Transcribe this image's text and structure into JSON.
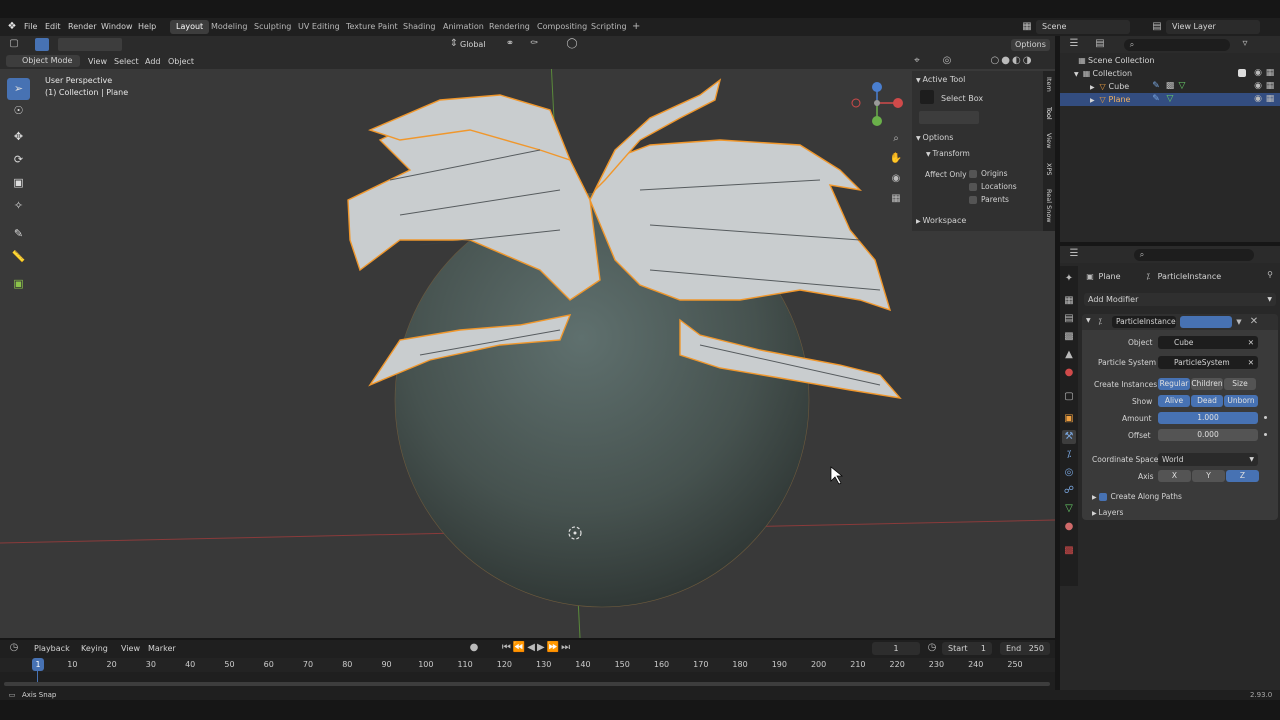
{
  "menubar": {
    "items": [
      "File",
      "Edit",
      "Render",
      "Window",
      "Help"
    ]
  },
  "workspaces": {
    "tabs": [
      "Layout",
      "Modeling",
      "Sculpting",
      "UV Editing",
      "Texture Paint",
      "Shading",
      "Animation",
      "Rendering",
      "Compositing",
      "Scripting"
    ],
    "active": "Layout",
    "add": "+"
  },
  "topright": {
    "scene": "Scene",
    "view_layer": "View Layer"
  },
  "viewport": {
    "mode": "Object Mode",
    "menu": [
      "View",
      "Select",
      "Add",
      "Object"
    ],
    "transform_orientation": "Global",
    "options": "Options",
    "perspective": "User Perspective",
    "collection_info": "(1) Collection | Plane"
  },
  "npanel": {
    "active_tool_header": "Active Tool",
    "tool_name": "Select Box",
    "options_header": "Options",
    "transform_header": "Transform",
    "affect_only_label": "Affect Only",
    "affect_options": [
      "Origins",
      "Locations",
      "Parents"
    ],
    "workspace_header": "Workspace",
    "tabs": [
      "Item",
      "Tool",
      "View",
      "XPS",
      "Real Snow"
    ]
  },
  "outliner": {
    "root": "Scene Collection",
    "collection": "Collection",
    "items": [
      "Cube",
      "Plane"
    ]
  },
  "properties": {
    "object_name": "Plane",
    "modifier_breadcrumb": "ParticleInstance",
    "add_modifier": "Add Modifier",
    "modifier_name": "ParticleInstance",
    "object_label": "Object",
    "object_value": "Cube",
    "particle_system_label": "Particle System",
    "particle_system_value": "ParticleSystem",
    "create_instances_label": "Create Instances",
    "create_instances": [
      "Regular",
      "Children",
      "Size"
    ],
    "show_label": "Show",
    "show": [
      "Alive",
      "Dead",
      "Unborn"
    ],
    "amount_label": "Amount",
    "amount_value": "1.000",
    "offset_label": "Offset",
    "offset_value": "0.000",
    "coord_space_label": "Coordinate Space",
    "coord_space_value": "World",
    "axis_label": "Axis",
    "axis": [
      "X",
      "Y",
      "Z"
    ],
    "create_along_paths": "Create Along Paths",
    "layers": "Layers"
  },
  "timeline": {
    "menu": [
      "Playback",
      "Keying",
      "View",
      "Marker"
    ],
    "current_frame": "1",
    "start_label": "Start",
    "start_value": "1",
    "end_label": "End",
    "end_value": "250",
    "ticks": [
      "1",
      "10",
      "20",
      "30",
      "40",
      "50",
      "60",
      "70",
      "80",
      "90",
      "100",
      "110",
      "120",
      "130",
      "140",
      "150",
      "160",
      "170",
      "180",
      "190",
      "200",
      "210",
      "220",
      "230",
      "240",
      "250"
    ]
  },
  "status": {
    "left": "Axis Snap",
    "version": "2.93.0"
  },
  "colors": {
    "accent": "#4772b3",
    "selection": "#f5a03a",
    "sphere": "#4a5a58"
  }
}
